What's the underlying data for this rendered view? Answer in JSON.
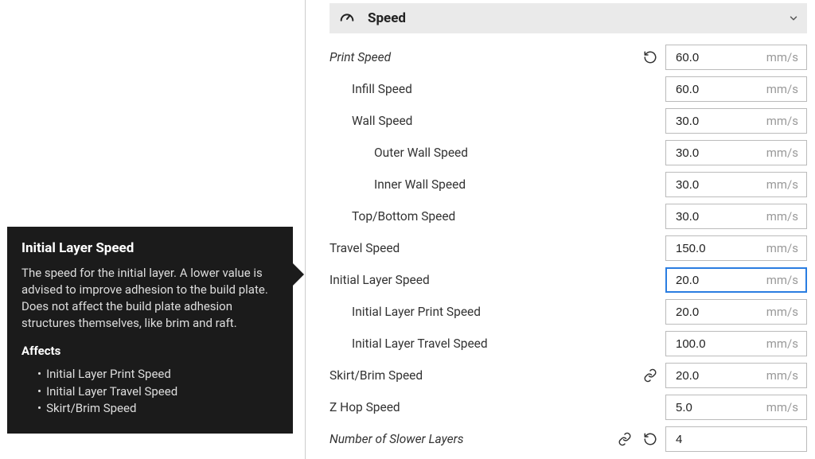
{
  "section": {
    "title": "Speed"
  },
  "tooltip": {
    "title": "Initial Layer Speed",
    "body": "The speed for the initial layer. A lower value is advised to improve adhesion to the build plate. Does not affect the build plate adhesion structures themselves, like brim and raft.",
    "affects_label": "Affects",
    "affects": [
      "Initial Layer Print Speed",
      "Initial Layer Travel Speed",
      "Skirt/Brim Speed"
    ]
  },
  "settings": {
    "print_speed": {
      "label": "Print Speed",
      "value": "60.0",
      "unit": "mm/s"
    },
    "infill_speed": {
      "label": "Infill Speed",
      "value": "60.0",
      "unit": "mm/s"
    },
    "wall_speed": {
      "label": "Wall Speed",
      "value": "30.0",
      "unit": "mm/s"
    },
    "outer_wall_speed": {
      "label": "Outer Wall Speed",
      "value": "30.0",
      "unit": "mm/s"
    },
    "inner_wall_speed": {
      "label": "Inner Wall Speed",
      "value": "30.0",
      "unit": "mm/s"
    },
    "top_bottom_speed": {
      "label": "Top/Bottom Speed",
      "value": "30.0",
      "unit": "mm/s"
    },
    "travel_speed": {
      "label": "Travel Speed",
      "value": "150.0",
      "unit": "mm/s"
    },
    "initial_layer_speed": {
      "label": "Initial Layer Speed",
      "value": "20.0",
      "unit": "mm/s"
    },
    "initial_layer_print_speed": {
      "label": "Initial Layer Print Speed",
      "value": "20.0",
      "unit": "mm/s"
    },
    "initial_layer_travel_speed": {
      "label": "Initial Layer Travel Speed",
      "value": "100.0",
      "unit": "mm/s"
    },
    "skirt_brim_speed": {
      "label": "Skirt/Brim Speed",
      "value": "20.0",
      "unit": "mm/s"
    },
    "z_hop_speed": {
      "label": "Z Hop Speed",
      "value": "5.0",
      "unit": "mm/s"
    },
    "num_slower_layers": {
      "label": "Number of Slower Layers",
      "value": "4",
      "unit": ""
    }
  }
}
